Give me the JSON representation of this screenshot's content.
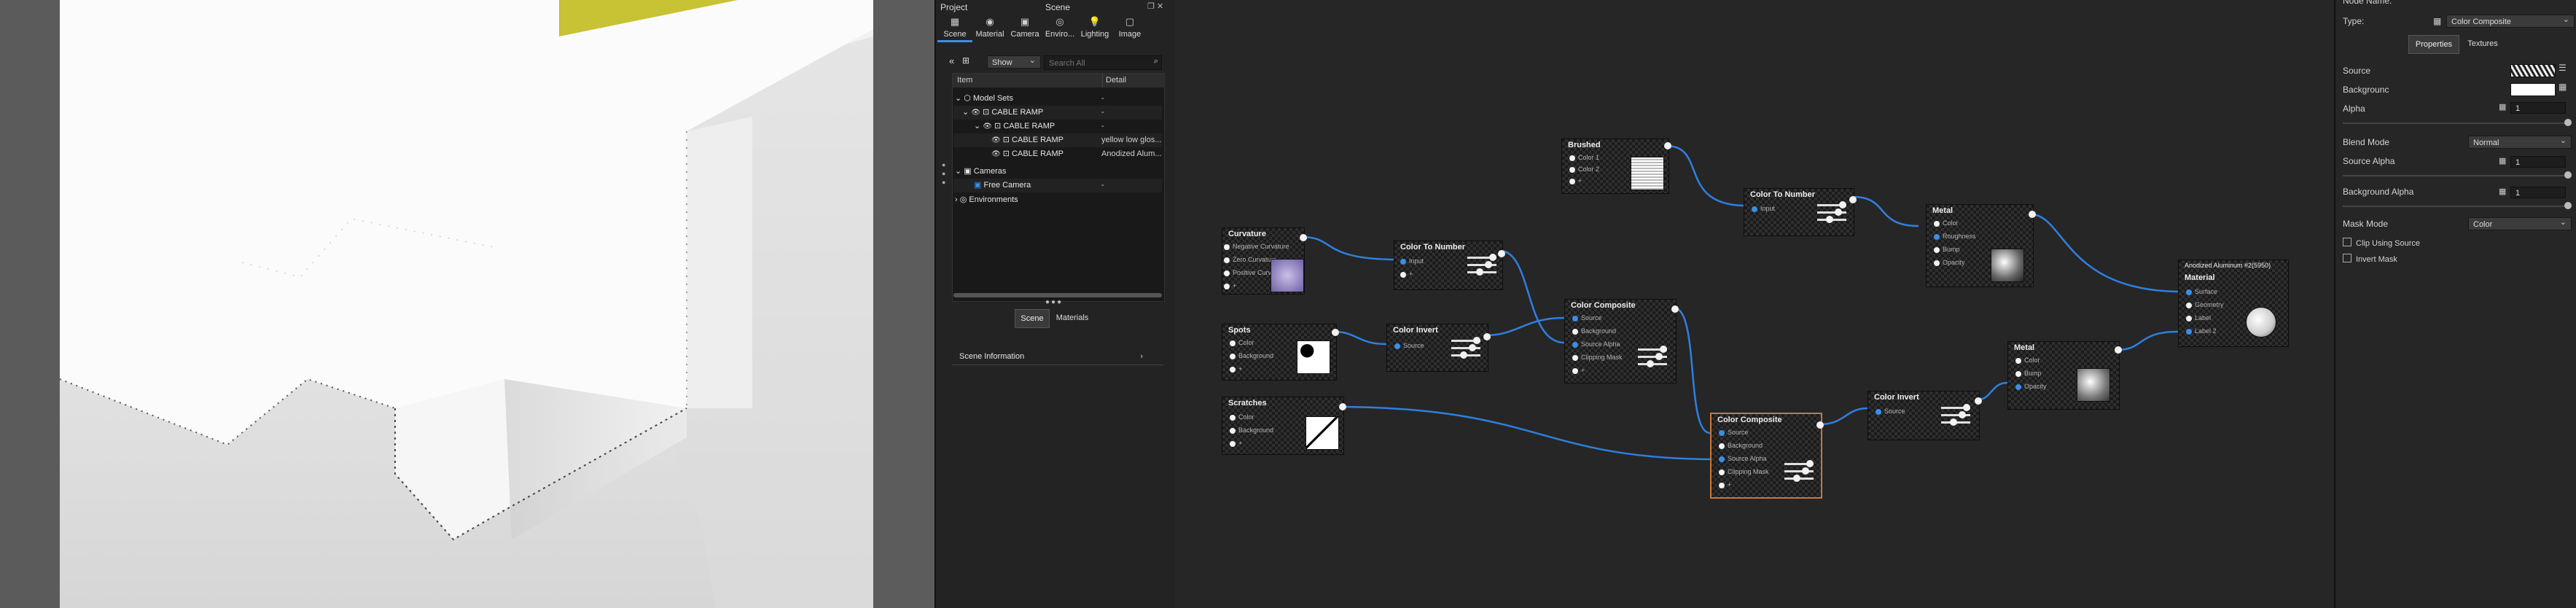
{
  "scene_panel": {
    "project_label": "Project",
    "title": "Scene",
    "tabs": [
      {
        "label": "Scene",
        "icon": "scene-icon"
      },
      {
        "label": "Material",
        "icon": "material-icon"
      },
      {
        "label": "Camera",
        "icon": "camera-icon"
      },
      {
        "label": "Enviro...",
        "icon": "environment-icon"
      },
      {
        "label": "Lighting",
        "icon": "lighting-icon"
      },
      {
        "label": "Image",
        "icon": "image-icon"
      }
    ],
    "show_select": "Show",
    "search_placeholder": "Search All",
    "columns": {
      "item": "Item",
      "detail": "Detail"
    },
    "tree": [
      {
        "label": "Model Sets",
        "detail": "-"
      },
      {
        "label": "CABLE RAMP",
        "detail": "-"
      },
      {
        "label": "CABLE RAMP",
        "detail": "-"
      },
      {
        "label": "CABLE RAMP",
        "detail": "yellow low glos..."
      },
      {
        "label": "CABLE RAMP",
        "detail": "Anodized Alum..."
      },
      {
        "label": "Cameras",
        "detail": ""
      },
      {
        "label": "Free Camera",
        "detail": "-"
      },
      {
        "label": "Environments",
        "detail": ""
      }
    ],
    "bottom_tabs": [
      "Scene",
      "Materials"
    ],
    "scene_information": "Scene Information"
  },
  "graph": {
    "nodes": {
      "brushed": {
        "title": "Brushed",
        "ports": [
          "Color 1",
          "Color 2",
          "+"
        ]
      },
      "curvature": {
        "title": "Curvature",
        "ports": [
          "Negative Curvature",
          "Zero Curvature",
          "Positive Curvature",
          "+"
        ]
      },
      "ctn1": {
        "title": "Color To Number",
        "ports": [
          "Input",
          "+"
        ]
      },
      "ctn2": {
        "title": "Color To Number",
        "ports": [
          "Input"
        ]
      },
      "metal1": {
        "title": "Metal",
        "ports": [
          "Color",
          "Roughness",
          "Bump",
          "Opacity"
        ]
      },
      "metal2": {
        "title": "Metal",
        "ports": [
          "Color",
          "Bump",
          "Opacity"
        ]
      },
      "spots": {
        "title": "Spots",
        "ports": [
          "Color",
          "Background",
          "+"
        ]
      },
      "cinv1": {
        "title": "Color Invert",
        "ports": [
          "Source"
        ]
      },
      "cinv2": {
        "title": "Color Invert",
        "ports": [
          "Source"
        ]
      },
      "ccomp1": {
        "title": "Color Composite",
        "ports": [
          "Source",
          "Background",
          "Source Alpha",
          "Clipping Mask",
          "+"
        ]
      },
      "ccomp2": {
        "title": "Color Composite",
        "ports": [
          "Source",
          "Background",
          "Source Alpha",
          "Clipping Mask",
          "+"
        ]
      },
      "scratches": {
        "title": "Scratches",
        "ports": [
          "Color",
          "Background",
          "+"
        ]
      },
      "material": {
        "header": "Anodized Aluminum #2(5950)",
        "title": "Material",
        "ports": [
          "Surface",
          "Geometry",
          "Label",
          "Label 2"
        ]
      }
    }
  },
  "properties": {
    "node_name_label": "Node Name:",
    "type_label": "Type:",
    "type_value": "Color Composite",
    "tabs": [
      "Properties",
      "Textures"
    ],
    "source_label": "Source",
    "background_label": "Backgrounc",
    "alpha_label": "Alpha",
    "alpha_value": "1",
    "blend_mode_label": "Blend Mode",
    "blend_mode_value": "Normal",
    "source_alpha_label": "Source Alpha",
    "source_alpha_value": "1",
    "background_alpha_label": "Background Alpha",
    "background_alpha_value": "1",
    "mask_mode_label": "Mask Mode",
    "mask_mode_value": "Color",
    "clip_label": "Clip Using Source",
    "invert_label": "Invert Mask"
  }
}
